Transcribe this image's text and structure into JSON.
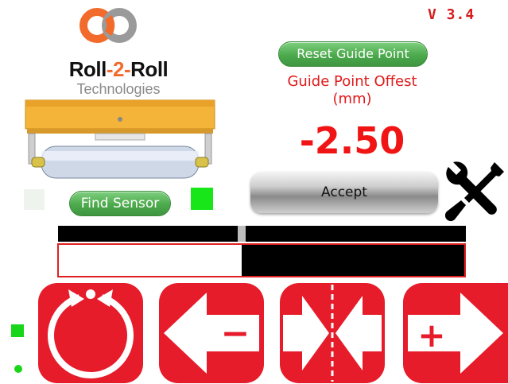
{
  "version": "V 3.4",
  "brand": {
    "name_part1": "Roll",
    "name_dash1": "-",
    "name_part2": "2",
    "name_dash2": "-",
    "name_part3": "Roll",
    "subtitle": "Technologies"
  },
  "find_sensor_label": "Find Sensor",
  "reset_guide_label": "Reset Guide Point",
  "offset": {
    "label_line1": "Guide Point Offest",
    "label_line2": "(mm)",
    "value": "-2.50"
  },
  "accept_label": "Accept",
  "position": {
    "marker_fraction": 0.45,
    "bottom_fill_fraction": 0.55
  },
  "controls": [
    {
      "name": "auto",
      "icon": "auto-center-icon"
    },
    {
      "name": "move-left",
      "icon": "arrow-left-minus-icon",
      "symbol": "−"
    },
    {
      "name": "center",
      "icon": "center-arrows-icon"
    },
    {
      "name": "move-right",
      "icon": "arrow-right-plus-icon",
      "symbol": "+"
    }
  ],
  "colors": {
    "accent_red": "#e61c2b",
    "indicator_green": "#19e619",
    "pill_green": "#4caa4c",
    "logo_orange": "#f26b2b",
    "logo_gray": "#8a8a8a"
  }
}
